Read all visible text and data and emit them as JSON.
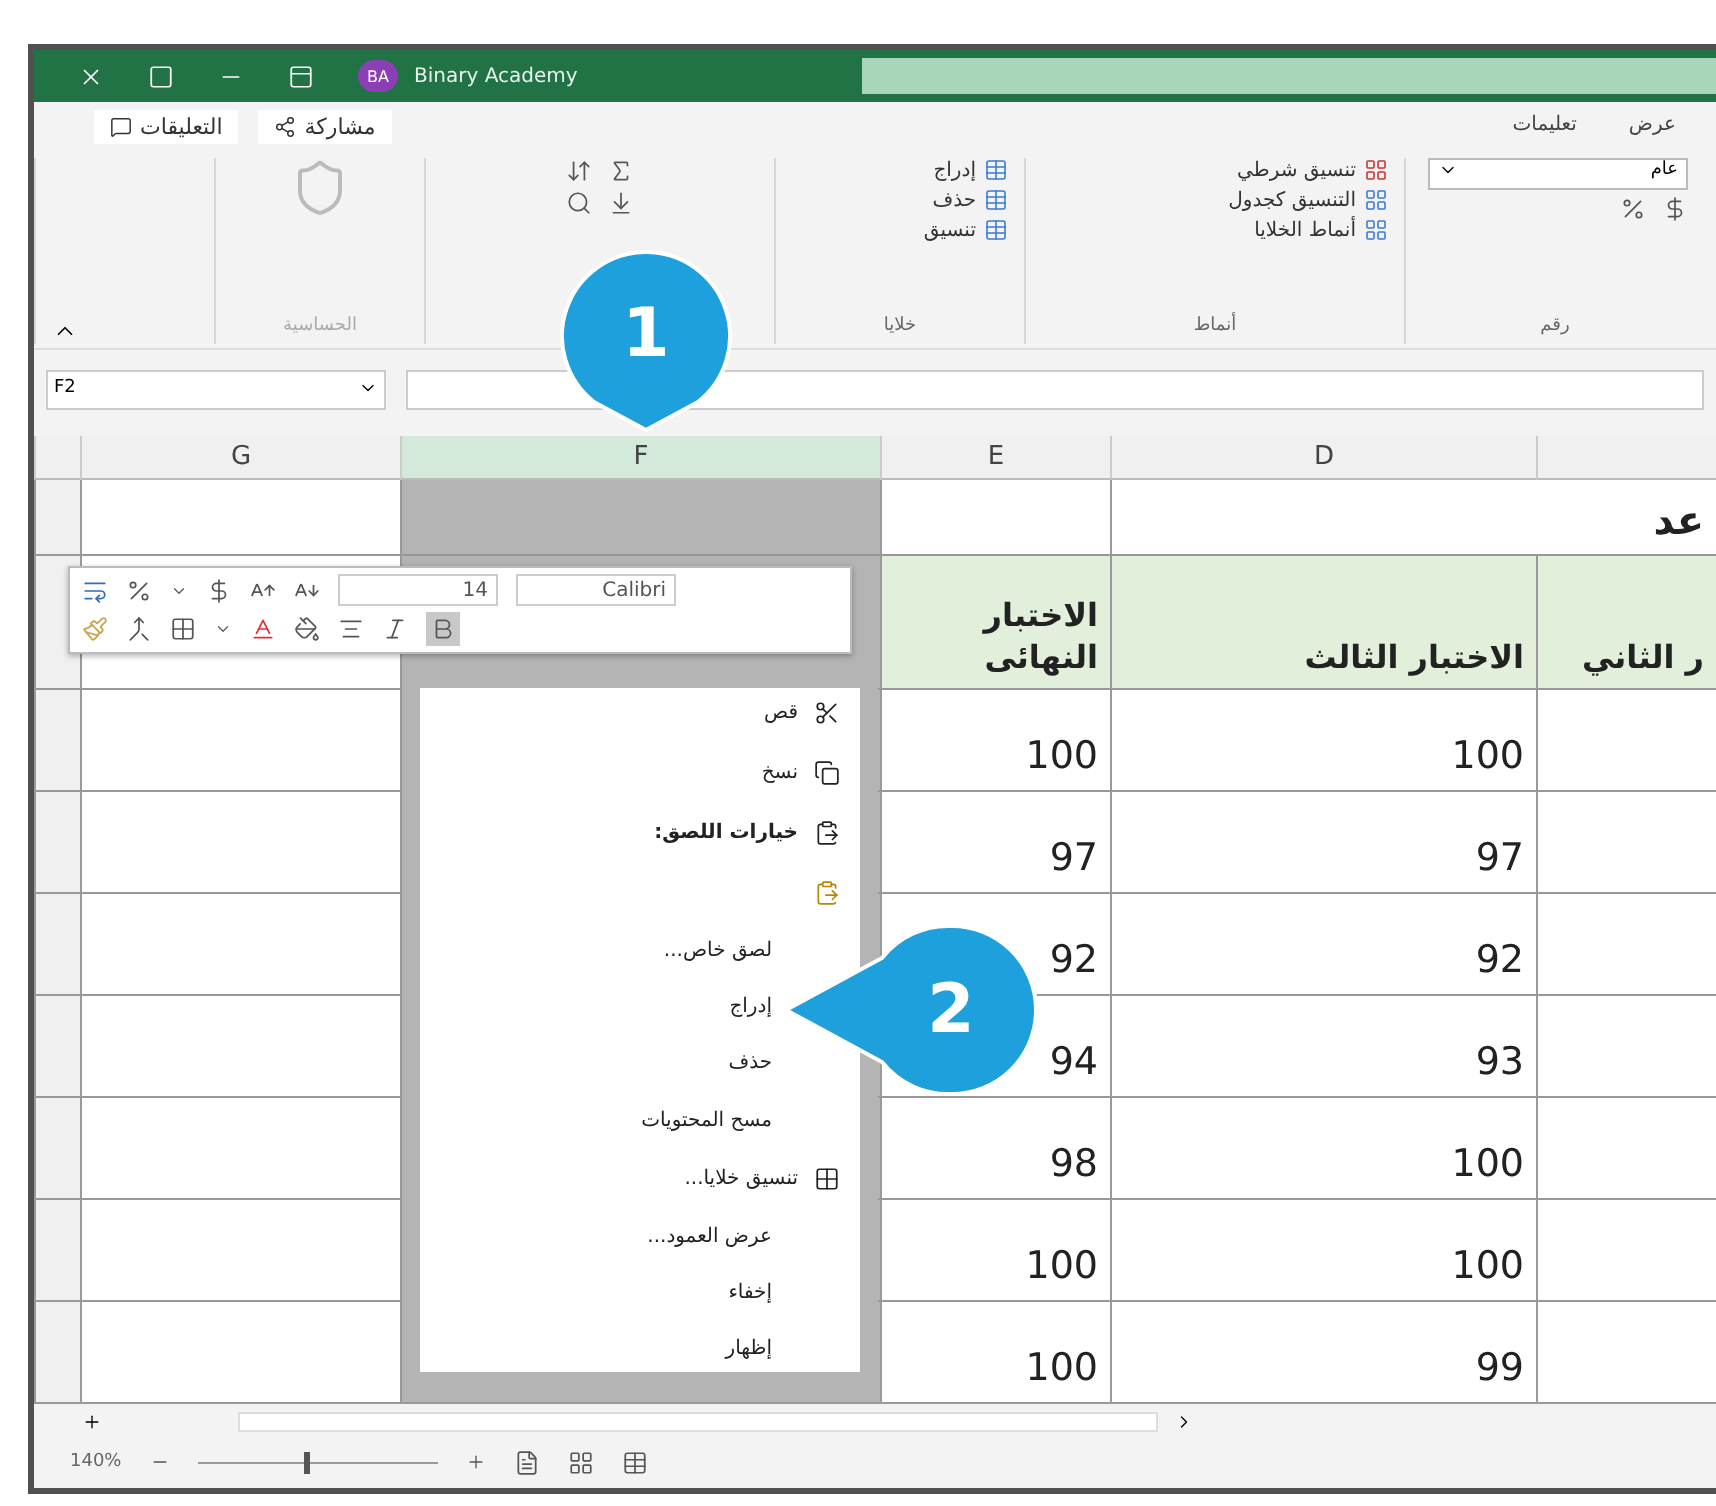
{
  "window": {
    "title": "Binary Academy",
    "avatar": "BA"
  },
  "ribbon": {
    "tabs": [
      {
        "label": "عرض",
        "selected": false
      },
      {
        "label": "تعليمات",
        "selected": false
      }
    ],
    "share": "مشاركة",
    "comments": "التعليقات",
    "sensitivity": {
      "label": "الحساسية",
      "disabled": true
    },
    "cells_group": {
      "label": "خلايا",
      "items": [
        "إدراج",
        "حذف",
        "تنسيق"
      ]
    },
    "styles_group": {
      "label": "أنماط",
      "items": [
        "تنسيق شرطي",
        "التنسيق كجدول",
        "أنماط الخلايا"
      ]
    },
    "number_group": {
      "label": "رقم",
      "format": "عام"
    }
  },
  "name_box": "F2",
  "columns": [
    {
      "label": "D",
      "selected": false
    },
    {
      "label": "E",
      "selected": false
    },
    {
      "label": "F",
      "selected": true
    },
    {
      "label": "G",
      "selected": false
    }
  ],
  "title_cell": "عد",
  "header_cells": {
    "c": "ر الثاني",
    "d": "الاختبار الثالث",
    "e": "الاختبار النهائى"
  },
  "rows": [
    {
      "d": "100",
      "e": "100"
    },
    {
      "d": "97",
      "e": "97"
    },
    {
      "d": "92",
      "e": "92"
    },
    {
      "d": "93",
      "e": "94"
    },
    {
      "d": "100",
      "e": "98"
    },
    {
      "d": "100",
      "e": "100"
    },
    {
      "d": "99",
      "e": "100"
    }
  ],
  "mini_toolbar": {
    "font": "Calibri",
    "size": "14",
    "bold": true
  },
  "context_menu": [
    {
      "kind": "cut",
      "label": "قص"
    },
    {
      "kind": "copy",
      "label": "نسخ"
    },
    {
      "kind": "paste_header",
      "label": "خيارات اللصق:"
    },
    {
      "kind": "paste_option"
    },
    {
      "kind": "plain",
      "label": "لصق خاص..."
    },
    {
      "kind": "plain",
      "label": "إدراج"
    },
    {
      "kind": "plain",
      "label": "حذف"
    },
    {
      "kind": "plain",
      "label": "مسح المحتويات"
    },
    {
      "kind": "format",
      "label": "تنسيق خلايا..."
    },
    {
      "kind": "plain",
      "label": "عرض العمود..."
    },
    {
      "kind": "plain",
      "label": "إخفاء"
    },
    {
      "kind": "plain",
      "label": "إظهار"
    }
  ],
  "callouts": [
    "1",
    "2"
  ],
  "status_bar": {
    "zoom": "140%",
    "zoom_slider": {
      "level": 0.45
    }
  }
}
